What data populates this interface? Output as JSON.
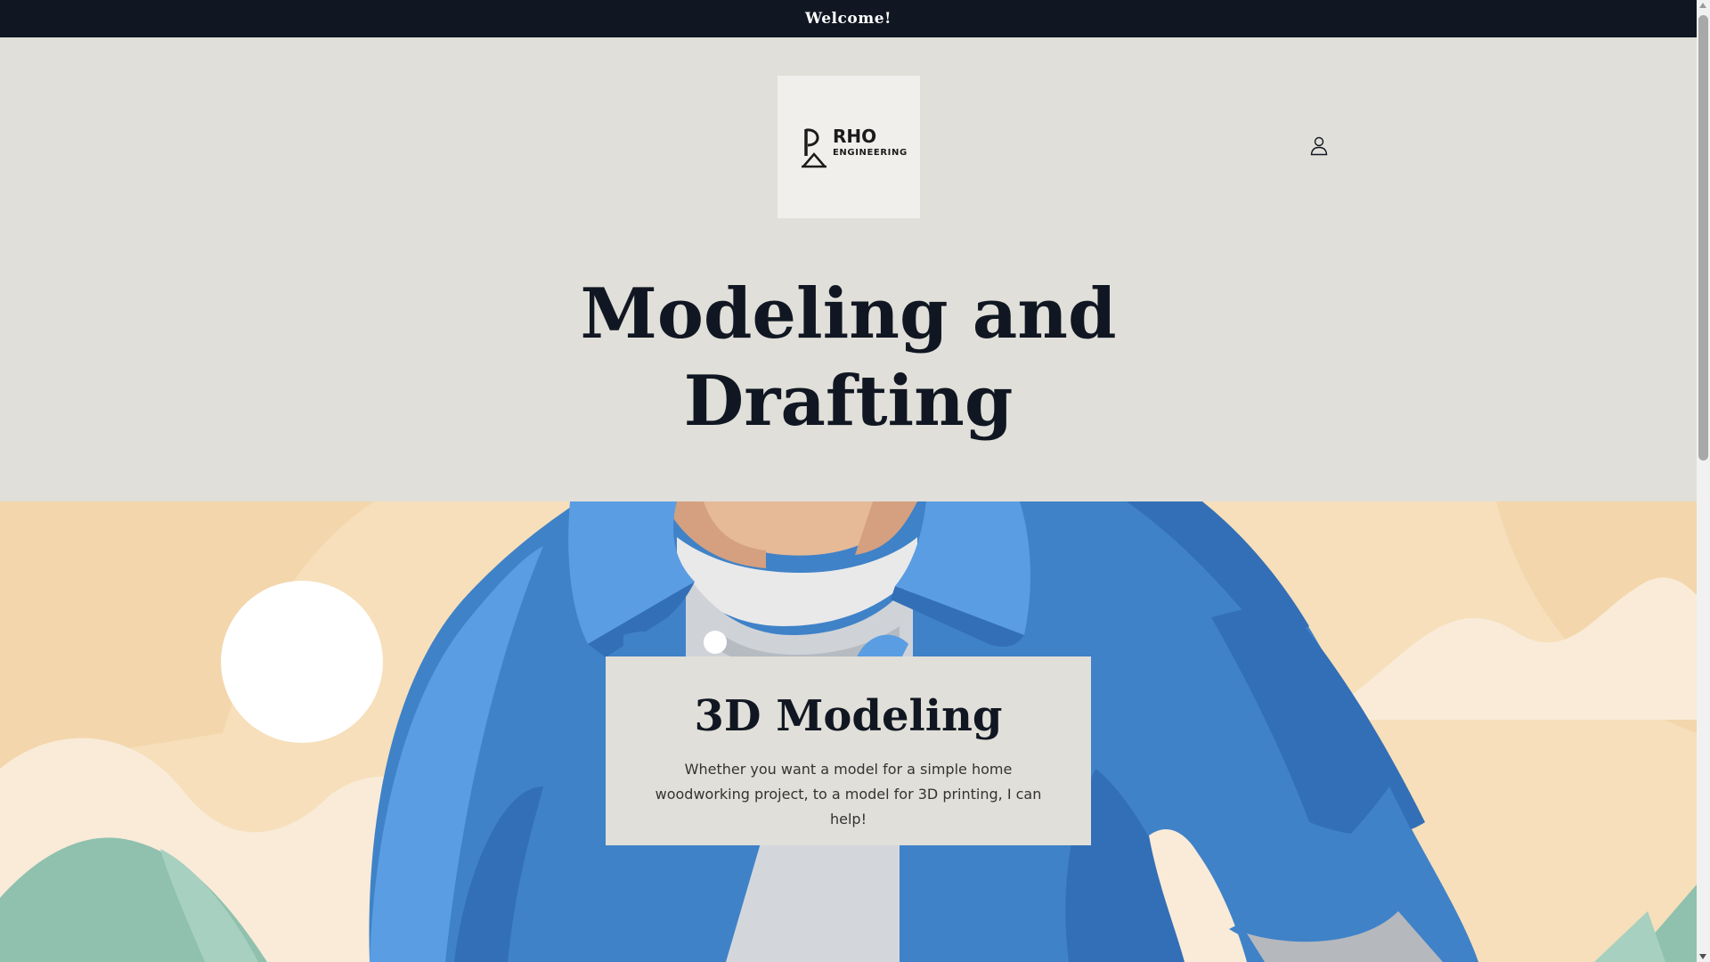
{
  "announcement": {
    "text": "Welcome!"
  },
  "logo": {
    "line1": "RHO",
    "line2": "ENGINEERING"
  },
  "header": {
    "account_icon": "user-account-icon"
  },
  "hero": {
    "title_line1": "Modeling and",
    "title_line2": "Drafting"
  },
  "card": {
    "title": "3D Modeling",
    "text": "Whether you want a model for a simple home woodworking project, to a model for 3D printing, I can help!"
  },
  "colors": {
    "announcement_bg": "#111722",
    "page_bg": "#e0dfd9",
    "banner_sand": "#f6dfba",
    "jacket_blue": "#3f82c8",
    "hills_green": "#8fc1ae"
  }
}
